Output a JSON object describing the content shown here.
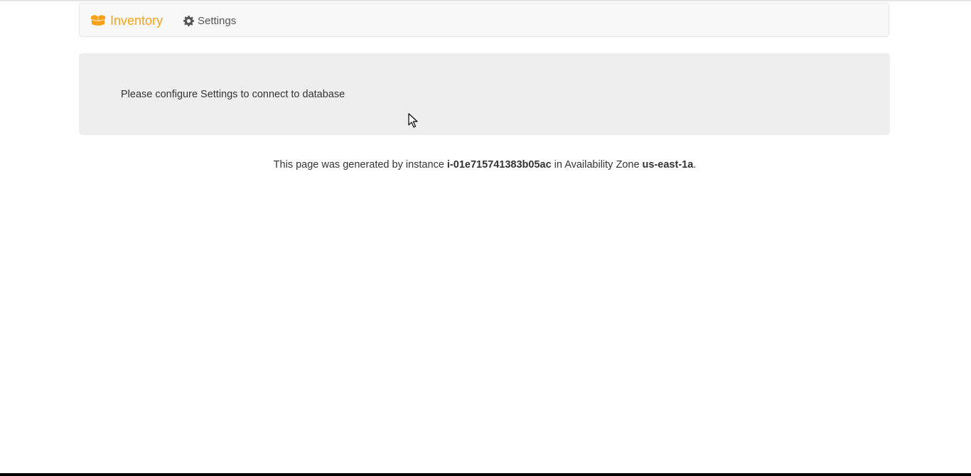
{
  "navbar": {
    "brand_label": "Inventory",
    "brand_icon": "boxes-icon",
    "settings_label": "Settings",
    "settings_icon": "gear-icon"
  },
  "jumbotron": {
    "message": "Please configure Settings to connect to database"
  },
  "footer": {
    "prefix": "This page was generated by instance ",
    "instance_id": "i-01e715741383b05ac",
    "middle": " in Availability Zone ",
    "zone": "us-east-1a",
    "suffix": "."
  },
  "colors": {
    "brand": "#f7a11a",
    "navbar_bg": "#f8f8f8",
    "jumbotron_bg": "#eeeeee",
    "text": "#333333"
  }
}
